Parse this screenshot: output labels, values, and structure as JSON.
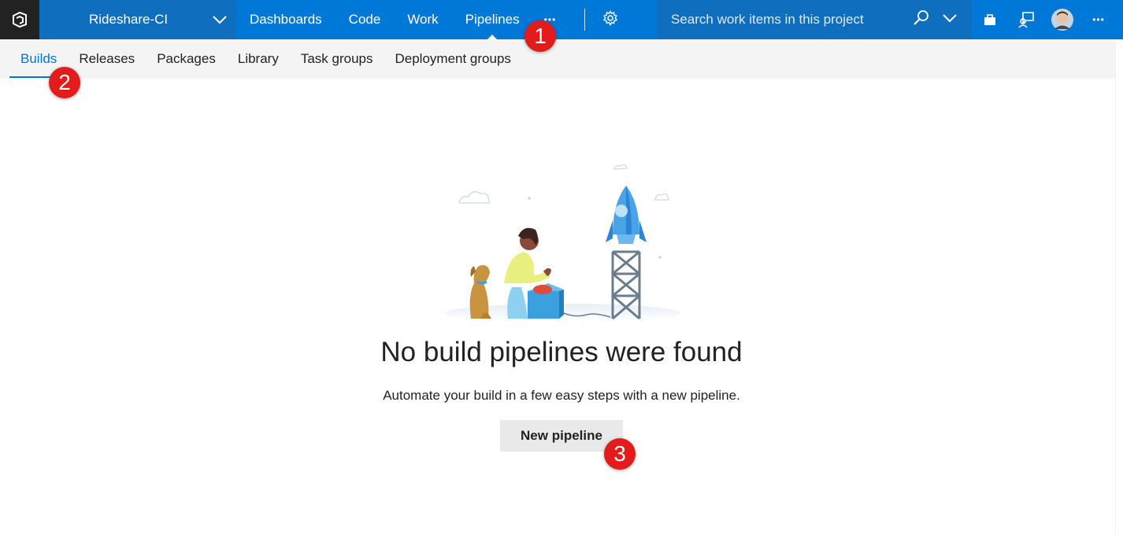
{
  "topbar": {
    "project_name": "Rideshare-CI",
    "nav": [
      {
        "label": "Dashboards"
      },
      {
        "label": "Code"
      },
      {
        "label": "Work"
      },
      {
        "label": "Pipelines"
      }
    ],
    "more_label": "•••",
    "search_placeholder": "Search work items in this project",
    "menu_label": "•••",
    "accent": "#0078d7",
    "dark_accent": "#106ebe",
    "icons": [
      "vsts-logo-icon",
      "chevron-down-icon",
      "gear-icon",
      "search-icon",
      "marketplace-bag-icon",
      "feedback-icon",
      "avatar"
    ]
  },
  "subnav": {
    "items": [
      {
        "label": "Builds"
      },
      {
        "label": "Releases"
      },
      {
        "label": "Packages"
      },
      {
        "label": "Library"
      },
      {
        "label": "Task groups"
      },
      {
        "label": "Deployment groups"
      }
    ],
    "active": "Builds"
  },
  "empty_state": {
    "heading": "No build pipelines were found",
    "description": "Automate your build in a few easy steps with a new pipeline.",
    "button_label": "New pipeline",
    "illustration": "rocket-launch-illustration"
  },
  "markers": [
    {
      "label": "1"
    },
    {
      "label": "2"
    },
    {
      "label": "3"
    }
  ],
  "marker_color": "#e21b1b"
}
